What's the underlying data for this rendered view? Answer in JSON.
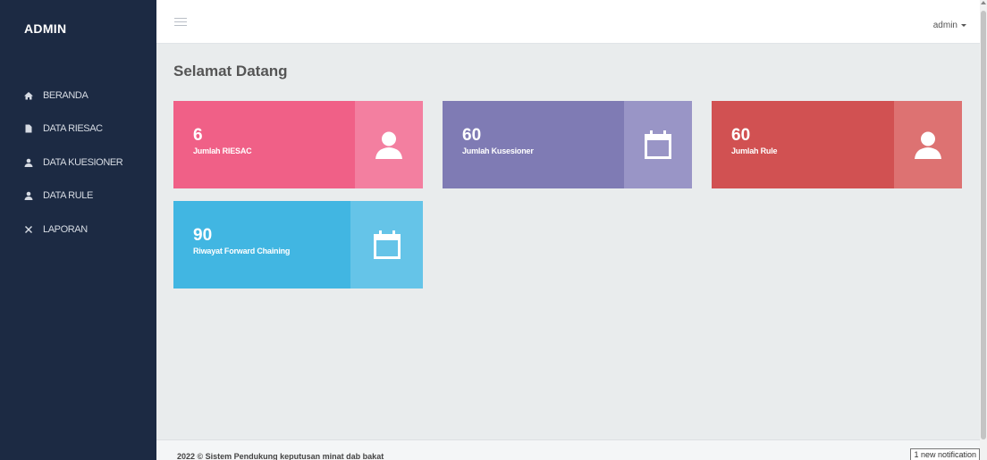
{
  "brand": "ADMIN",
  "sidebar": {
    "items": [
      {
        "label": "BERANDA",
        "icon": "home-icon"
      },
      {
        "label": "DATA RIESAC",
        "icon": "file-icon"
      },
      {
        "label": "DATA KUESIONER",
        "icon": "user-icon"
      },
      {
        "label": "DATA RULE",
        "icon": "user-icon"
      },
      {
        "label": "LAPORAN",
        "icon": "tools-icon"
      }
    ]
  },
  "header": {
    "user": "admin"
  },
  "main": {
    "title": "Selamat Datang",
    "cards": [
      {
        "value": "6",
        "label": "Jumlah RIESAC",
        "icon": "user-icon",
        "color": "#f06087"
      },
      {
        "value": "60",
        "label": "Jumlah Kusesioner",
        "icon": "calendar-icon",
        "color": "#7f7bb4"
      },
      {
        "value": "60",
        "label": "Jumlah Rule",
        "icon": "user-icon",
        "color": "#d15152"
      },
      {
        "value": "90",
        "label": "Riwayat Forward Chaining",
        "icon": "calendar-icon",
        "color": "#41b6e2"
      }
    ]
  },
  "footer": {
    "text": "2022 © Sistem Pendukung keputusan minat dab bakat"
  },
  "notification": "1 new notification"
}
